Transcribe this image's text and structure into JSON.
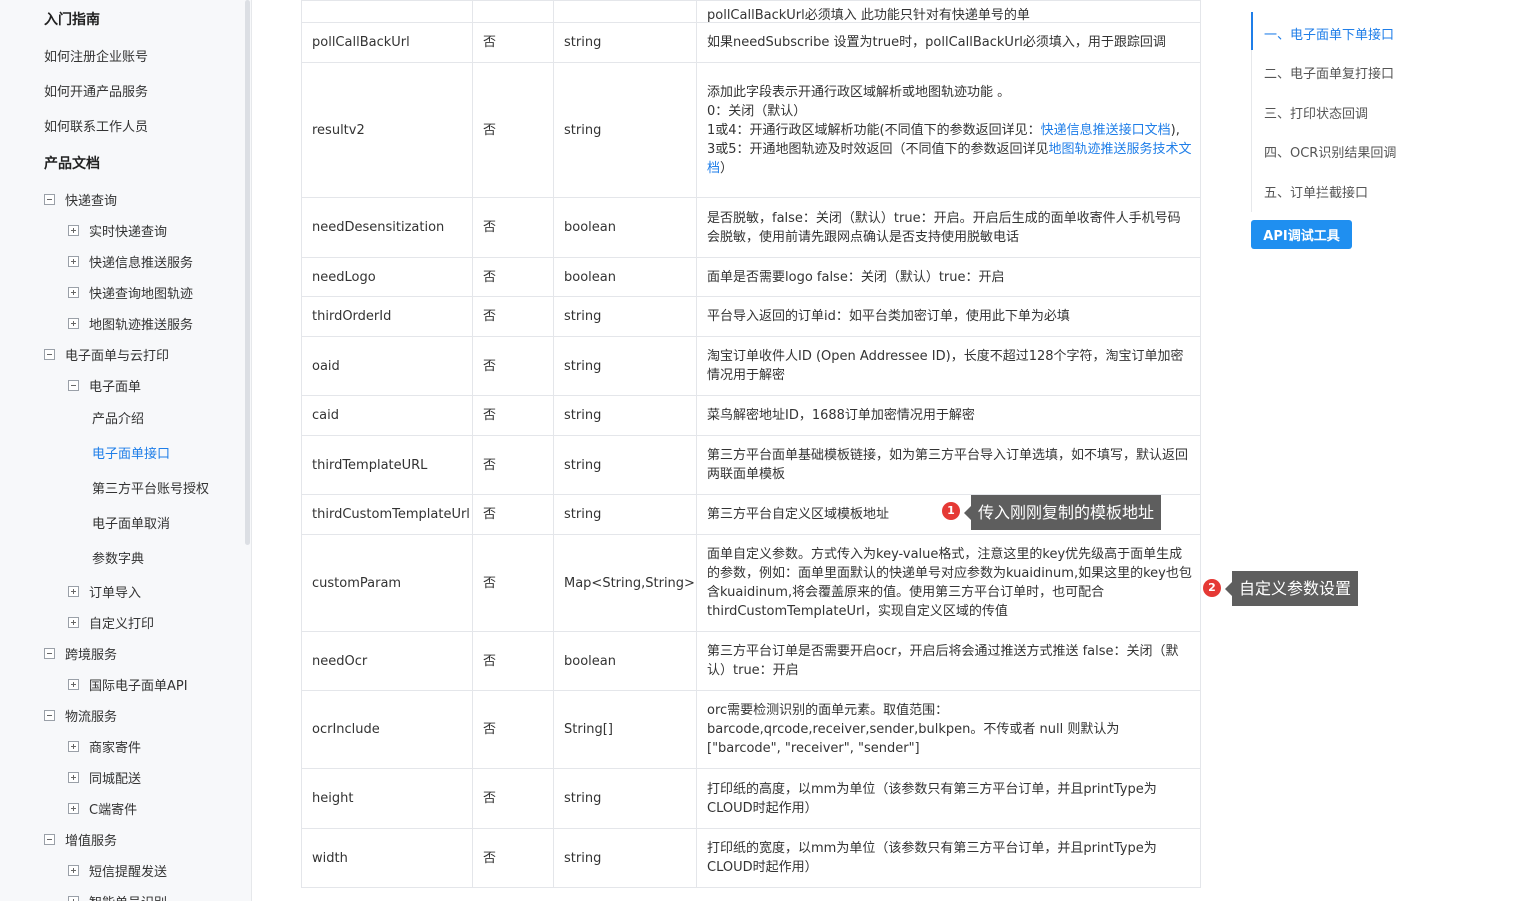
{
  "sidebar": {
    "section_getting_started": "入门指南",
    "links": [
      "如何注册企业账号",
      "如何开通产品服务",
      "如何联系工作人员"
    ],
    "section_products": "产品文档",
    "tree": [
      {
        "label": "快递查询",
        "toggle": "minus"
      },
      {
        "label": "实时快递查询",
        "toggle": "plus"
      },
      {
        "label": "快递信息推送服务",
        "toggle": "plus"
      },
      {
        "label": "快递查询地图轨迹",
        "toggle": "plus"
      },
      {
        "label": "地图轨迹推送服务",
        "toggle": "plus"
      },
      {
        "label": "电子面单与云打印",
        "toggle": "minus"
      },
      {
        "label": "电子面单",
        "toggle": "minus"
      },
      {
        "label": "产品介绍"
      },
      {
        "label": "电子面单接口"
      },
      {
        "label": "第三方平台账号授权"
      },
      {
        "label": "电子面单取消"
      },
      {
        "label": "参数字典"
      },
      {
        "label": "订单导入",
        "toggle": "plus"
      },
      {
        "label": "自定义打印",
        "toggle": "plus"
      },
      {
        "label": "跨境服务",
        "toggle": "minus"
      },
      {
        "label": "国际电子面单API",
        "toggle": "plus"
      },
      {
        "label": "物流服务",
        "toggle": "minus"
      },
      {
        "label": "商家寄件",
        "toggle": "plus"
      },
      {
        "label": "同城配送",
        "toggle": "plus"
      },
      {
        "label": "C端寄件",
        "toggle": "plus"
      },
      {
        "label": "增值服务",
        "toggle": "minus"
      },
      {
        "label": "短信提醒发送",
        "toggle": "plus"
      },
      {
        "label": "智能单号识别",
        "toggle": "plus"
      }
    ]
  },
  "table": {
    "top_clip_text": "pollCallBackUrl必须填入 此功能只针对有快递单号的单",
    "rows": [
      {
        "name": "pollCallBackUrl",
        "required": "否",
        "type": "string",
        "desc": "如果needSubscribe 设置为true时，pollCallBackUrl必须填入，用于跟踪回调"
      },
      {
        "name": "resultv2",
        "required": "否",
        "type": "string",
        "desc_line1": "添加此字段表示开通行政区域解析或地图轨迹功能 。",
        "desc_line2": "0：关闭（默认）",
        "desc_line3a": "1或4：开通行政区域解析功能(不同值下的参数返回详见：",
        "desc_link1": "快递信息推送接口文档",
        "desc_line3b": "),",
        "desc_line4a": "3或5：开通地图轨迹及时效返回（不同值下的参数返回详见",
        "desc_link2": "地图轨迹推送服务技术文档",
        "desc_line4b": "）"
      },
      {
        "name": "needDesensitization",
        "required": "否",
        "type": "boolean",
        "desc": "是否脱敏，false：关闭（默认）true：开启。开启后生成的面单收寄件人手机号码会脱敏，使用前请先跟网点确认是否支持使用脱敏电话"
      },
      {
        "name": "needLogo",
        "required": "否",
        "type": "boolean",
        "desc": "面单是否需要logo false：关闭（默认）true：开启"
      },
      {
        "name": "thirdOrderId",
        "required": "否",
        "type": "string",
        "desc": "平台导入返回的订单id：如平台类加密订单，使用此下单为必填"
      },
      {
        "name": "oaid",
        "required": "否",
        "type": "string",
        "desc": "淘宝订单收件人ID (Open Addressee ID)，长度不超过128个字符，淘宝订单加密情况用于解密"
      },
      {
        "name": "caid",
        "required": "否",
        "type": "string",
        "desc": "菜鸟解密地址ID，1688订单加密情况用于解密"
      },
      {
        "name": "thirdTemplateURL",
        "required": "否",
        "type": "string",
        "desc": "第三方平台面单基础模板链接，如为第三方平台导入订单选填，如不填写，默认返回两联面单模板"
      },
      {
        "name": "thirdCustomTemplateUrl",
        "required": "否",
        "type": "string",
        "desc": "第三方平台自定义区域模板地址"
      },
      {
        "name": "customParam",
        "required": "否",
        "type": "Map<String,String>",
        "desc": "面单自定义参数。方式传入为key-value格式，注意这里的key优先级高于面单生成的参数，例如：面单里面默认的快递单号对应参数为kuaidinum,如果这里的key也包含kuaidinum,将会覆盖原来的值。使用第三方平台订单时，也可配合thirdCustomTemplateUrl，实现自定义区域的传值"
      },
      {
        "name": "needOcr",
        "required": "否",
        "type": "boolean",
        "desc": "第三方平台订单是否需要开启ocr，开启后将会通过推送方式推送 false：关闭（默认）true：开启"
      },
      {
        "name": "ocrInclude",
        "required": "否",
        "type": "String[]",
        "desc": "orc需要检测识别的面单元素。取值范围：barcode,qrcode,receiver,sender,bulkpen。不传或者 null 则默认为 [\"barcode\", \"receiver\", \"sender\"]"
      },
      {
        "name": "height",
        "required": "否",
        "type": "string",
        "desc": "打印纸的高度，以mm为单位（该参数只有第三方平台订单，并且printType为CLOUD时起作用）"
      },
      {
        "name": "width",
        "required": "否",
        "type": "string",
        "desc": "打印纸的宽度，以mm为单位（该参数只有第三方平台订单，并且printType为CLOUD时起作用）"
      }
    ]
  },
  "toc": {
    "items": [
      "一、电子面单下单接口",
      "二、电子面单复打接口",
      "三、打印状态回调",
      "四、OCR识别结果回调",
      "五、订单拦截接口"
    ],
    "api_tool_label": "API调试工具"
  },
  "annotations": [
    {
      "badge": "1",
      "text": "传入刚刚复制的模板地址"
    },
    {
      "badge": "2",
      "text": "自定义参数设置"
    }
  ],
  "colors": {
    "accent": "#1f7ee8",
    "button": "#1f8ff0",
    "badge": "#e53935",
    "callout": "#5e5e5e"
  }
}
